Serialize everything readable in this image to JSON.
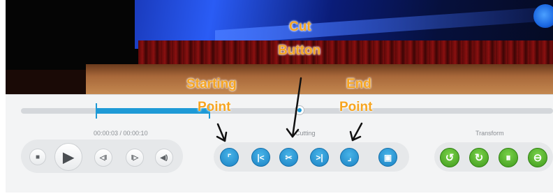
{
  "annotations": {
    "cut_line1": "Cut",
    "cut_line2": "Button",
    "start_line1": "Starting",
    "start_line2": "Point",
    "end_line1": "End",
    "end_line2": "Point"
  },
  "player": {
    "time_readout": "00:00:03 / 00:00:10",
    "selection_start": 0.14,
    "selection_end": 0.355,
    "playhead": 0.52
  },
  "sections": {
    "cutting": "Cutting",
    "transform": "Transform"
  },
  "playback_buttons": [
    {
      "icon": "stop-icon",
      "glyph": "■"
    },
    {
      "icon": "play-icon",
      "glyph": "▶"
    },
    {
      "icon": "step-back-icon",
      "glyph": "◁I"
    },
    {
      "icon": "step-forward-icon",
      "glyph": "I▷"
    },
    {
      "icon": "volume-icon",
      "glyph": "◀)"
    }
  ],
  "cutting_buttons": [
    {
      "icon": "set-start-icon",
      "glyph": "⌜"
    },
    {
      "icon": "jump-to-start-icon",
      "glyph": "|<"
    },
    {
      "icon": "scissors-icon",
      "glyph": "✂"
    },
    {
      "icon": "jump-to-end-icon",
      "glyph": ">|"
    },
    {
      "icon": "set-end-icon",
      "glyph": "⌟"
    },
    {
      "icon": "preview-icon",
      "glyph": "▣"
    }
  ],
  "transform_buttons": [
    {
      "icon": "rotate-left-icon",
      "glyph": "↺"
    },
    {
      "icon": "rotate-right-icon",
      "glyph": "↻"
    },
    {
      "icon": "flip-vertical-icon",
      "glyph": "⏸"
    },
    {
      "icon": "flip-horizontal-icon",
      "glyph": "⊖"
    }
  ],
  "colors": {
    "accent": "#1e9ad6",
    "annotation": "#f6a521",
    "transform": "#4aa82a"
  }
}
